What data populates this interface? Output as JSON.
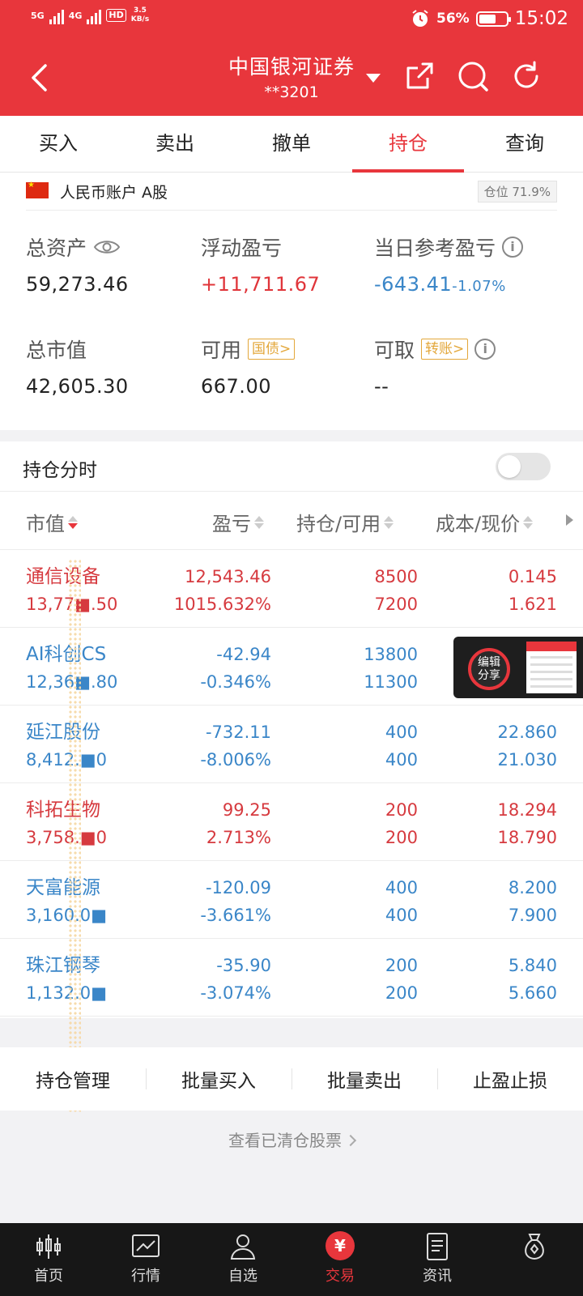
{
  "status_bar": {
    "network1": "5G",
    "network2": "4G",
    "hd": "HD",
    "speed_value": "3.5",
    "speed_unit": "KB/s",
    "battery": "56%",
    "time": "15:02"
  },
  "header": {
    "title": "中国银河证券",
    "account": "**3201"
  },
  "tabs": [
    {
      "label": "买入"
    },
    {
      "label": "卖出"
    },
    {
      "label": "撤单"
    },
    {
      "label": "持仓",
      "active": true
    },
    {
      "label": "查询"
    }
  ],
  "account": {
    "label": "人民币账户 A股",
    "position_ratio": "仓位 71.9%"
  },
  "summary": {
    "total_assets": {
      "label": "总资产",
      "value": "59,273.46"
    },
    "floating_pl": {
      "label": "浮动盈亏",
      "value": "+11,711.67"
    },
    "today_pl": {
      "label": "当日参考盈亏",
      "value": "-643.41",
      "pct": "-1.07%"
    },
    "market_value": {
      "label": "总市值",
      "value": "42,605.30"
    },
    "available": {
      "label": "可用",
      "value": "667.00",
      "tag": "国债>"
    },
    "withdrawable": {
      "label": "可取",
      "value": "--",
      "tag": "转账>"
    }
  },
  "intraday": {
    "label": "持仓分时",
    "enabled": false
  },
  "table": {
    "headers": [
      "市值",
      "盈亏",
      "持仓/可用",
      "成本/现价"
    ],
    "rows": [
      {
        "name": "通信设备",
        "market_value": "13,77■.50",
        "pl": "12,543.46",
        "pl_pct": "1015.632%",
        "hold": "8500",
        "avail": "7200",
        "cost": "0.145",
        "price": "1.621",
        "trend": "red"
      },
      {
        "name": "AI科创CS",
        "market_value": "12,36■.80",
        "pl": "-42.94",
        "pl_pct": "-0.346%",
        "hold": "13800",
        "avail": "11300",
        "cost": "",
        "price": "",
        "trend": "blue"
      },
      {
        "name": "延江股份",
        "market_value": "8,412.■0",
        "pl": "-732.11",
        "pl_pct": "-8.006%",
        "hold": "400",
        "avail": "400",
        "cost": "22.860",
        "price": "21.030",
        "trend": "blue"
      },
      {
        "name": "科拓生物",
        "market_value": "3,758.■0",
        "pl": "99.25",
        "pl_pct": "2.713%",
        "hold": "200",
        "avail": "200",
        "cost": "18.294",
        "price": "18.790",
        "trend": "red"
      },
      {
        "name": "天富能源",
        "market_value": "3,160.0■",
        "pl": "-120.09",
        "pl_pct": "-3.661%",
        "hold": "400",
        "avail": "400",
        "cost": "8.200",
        "price": "7.900",
        "trend": "blue"
      },
      {
        "name": "珠江钢琴",
        "market_value": "1,132.0■",
        "pl": "-35.90",
        "pl_pct": "-3.074%",
        "hold": "200",
        "avail": "200",
        "cost": "5.840",
        "price": "5.660",
        "trend": "blue"
      }
    ]
  },
  "share_widget": {
    "label": "编辑\n分享"
  },
  "actions": [
    "持仓管理",
    "批量买入",
    "批量卖出",
    "止盈止损"
  ],
  "cleared_link": "查看已清仓股票",
  "nav": [
    {
      "label": "首页",
      "icon": "candlestick-icon"
    },
    {
      "label": "行情",
      "icon": "chart-icon"
    },
    {
      "label": "自选",
      "icon": "person-icon"
    },
    {
      "label": "交易",
      "icon": "yen-icon",
      "active": true
    },
    {
      "label": "资讯",
      "icon": "document-icon"
    },
    {
      "label": "",
      "icon": "money-bag-icon"
    }
  ],
  "colors": {
    "brand": "#e8363c",
    "up": "#d63a3f",
    "down": "#3a86c8",
    "tag": "#e3a73a"
  }
}
